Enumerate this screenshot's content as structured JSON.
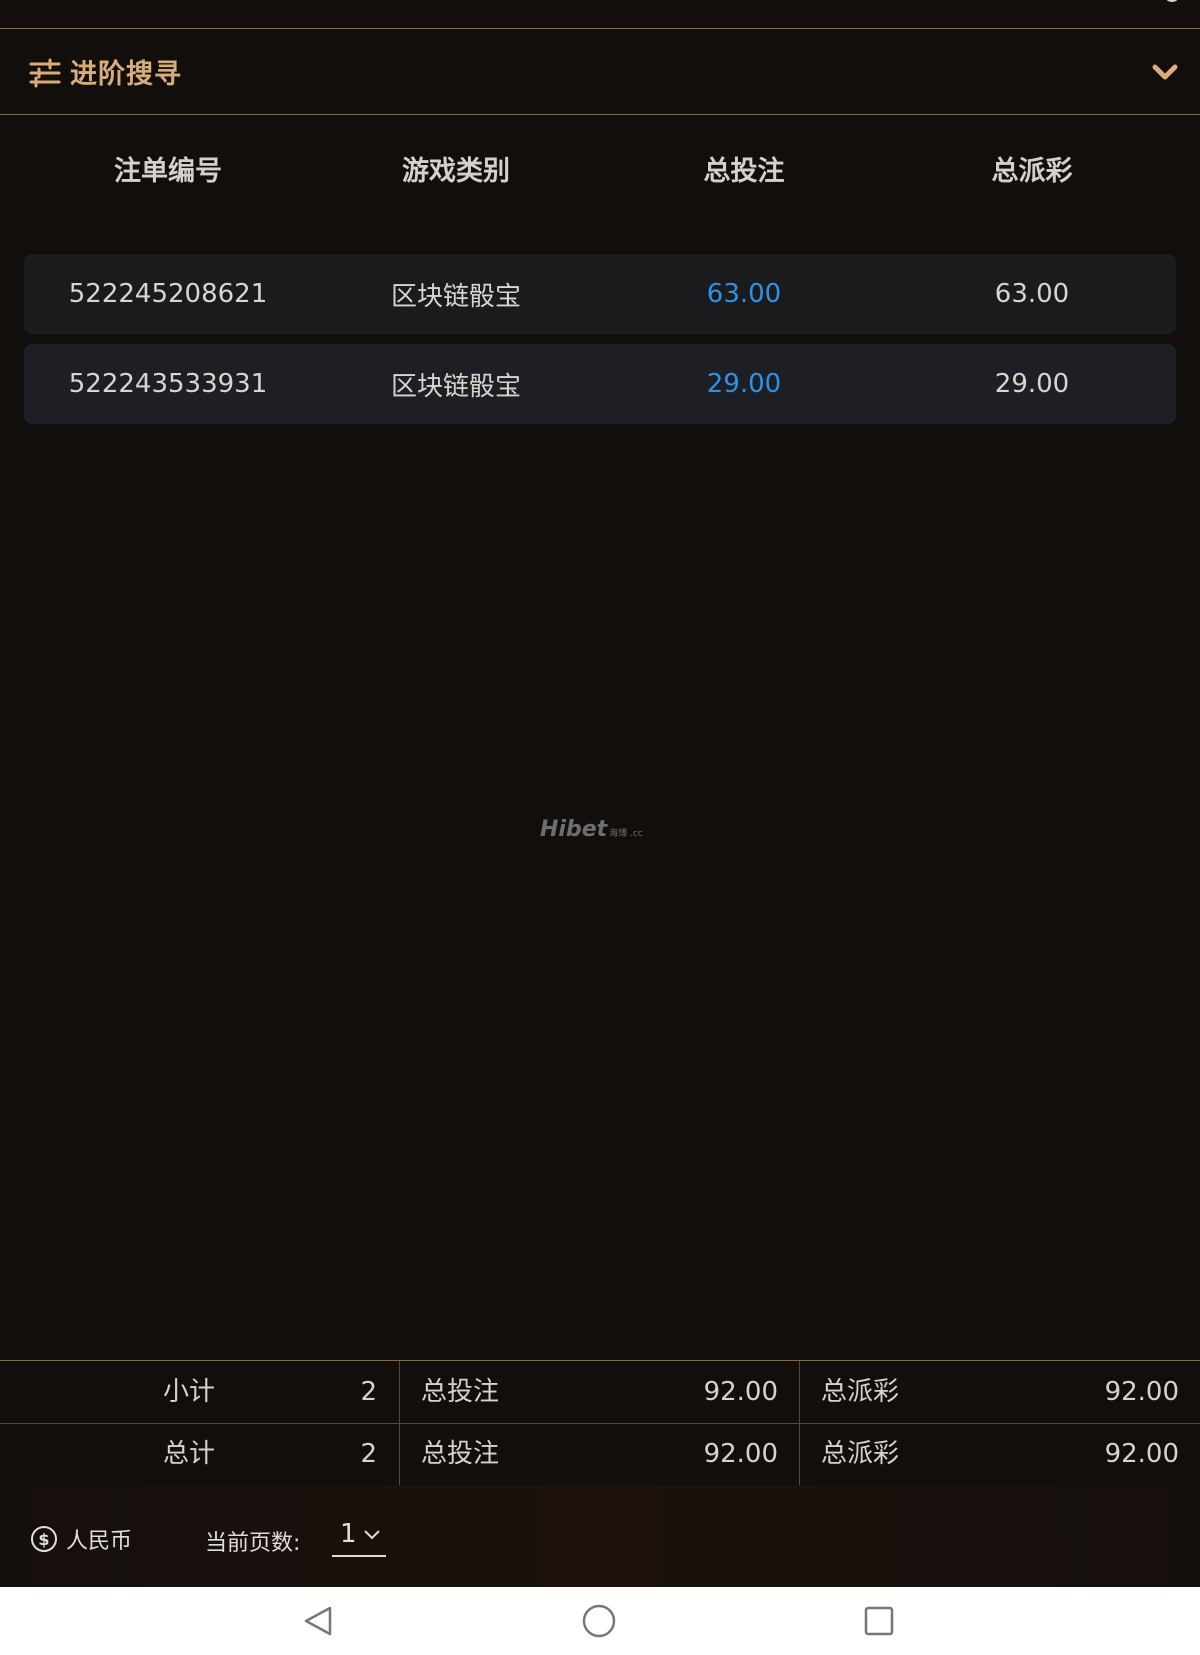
{
  "advanced_search": {
    "label": "进阶搜寻",
    "icon": "sliders-icon",
    "expand_icon": "chevron-down-icon",
    "accent_color": "#d9ad78"
  },
  "table": {
    "headers": [
      "注单编号",
      "游戏类别",
      "总投注",
      "总派彩"
    ],
    "rows": [
      {
        "id": "522245208621",
        "game": "区块链骰宝",
        "bet": "63.00",
        "payout": "63.00"
      },
      {
        "id": "522243533931",
        "game": "区块链骰宝",
        "bet": "29.00",
        "payout": "29.00"
      }
    ],
    "bet_color": "#2d92e6"
  },
  "watermark": {
    "text": "Hibet",
    "suffix": "海博 .cc"
  },
  "summary": {
    "subtotal": {
      "label": "小计",
      "count": "2",
      "bet_label": "总投注",
      "bet": "92.00",
      "payout_label": "总派彩",
      "payout": "92.00"
    },
    "total": {
      "label": "总计",
      "count": "2",
      "bet_label": "总投注",
      "bet": "92.00",
      "payout_label": "总派彩",
      "payout": "92.00"
    }
  },
  "footer": {
    "currency_icon": "dollar-circle-icon",
    "currency": "人民币",
    "page_label": "当前页数:",
    "page_value": "1"
  },
  "navbar": {
    "back_icon": "back-triangle-icon",
    "home_icon": "home-circle-icon",
    "recents_icon": "recents-square-icon"
  }
}
